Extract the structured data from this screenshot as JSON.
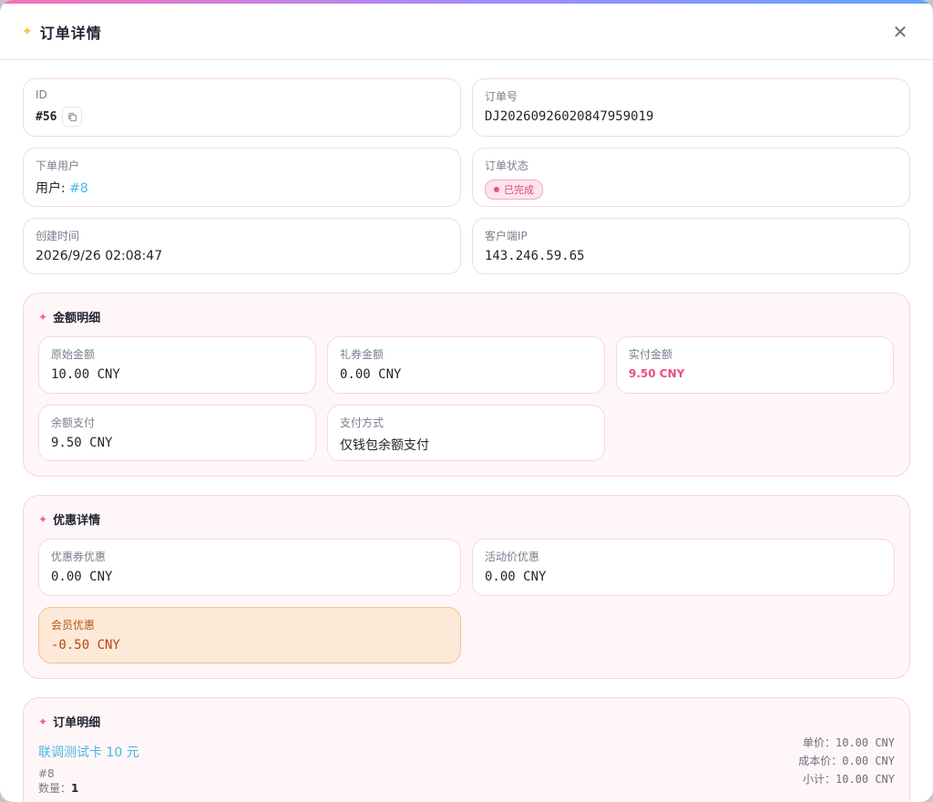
{
  "header": {
    "title": "订单详情",
    "close_icon": "close-icon"
  },
  "info": {
    "id": {
      "label": "ID",
      "value": "#56"
    },
    "order_no": {
      "label": "订单号",
      "value": "DJ20260926020847959019"
    },
    "user": {
      "label": "下单用户",
      "prefix": "用户:",
      "value": "#8"
    },
    "status": {
      "label": "订单状态",
      "value": "已完成"
    },
    "created": {
      "label": "创建时间",
      "value": "2026/9/26 02:08:47"
    },
    "ip": {
      "label": "客户端IP",
      "value": "143.246.59.65"
    }
  },
  "amounts": {
    "title": "金额明细",
    "items": [
      {
        "label": "原始金额",
        "value": "10.00 CNY"
      },
      {
        "label": "礼券金额",
        "value": "0.00 CNY"
      },
      {
        "label": "实付金额",
        "value": "9.50 CNY"
      },
      {
        "label": "余额支付",
        "value": "9.50 CNY"
      },
      {
        "label": "支付方式",
        "value": "仅钱包余额支付"
      }
    ]
  },
  "discounts": {
    "title": "优惠详情",
    "items": [
      {
        "label": "优惠券优惠",
        "value": "0.00 CNY"
      },
      {
        "label": "活动价优惠",
        "value": "0.00 CNY"
      },
      {
        "label": "会员优惠",
        "value": "-0.50 CNY"
      }
    ]
  },
  "order_items": {
    "title": "订单明细",
    "item": {
      "name": "联调测试卡 10 元",
      "id": "#8",
      "qty_label": "数量：",
      "qty": "1",
      "unit_price": "单价：10.00 CNY",
      "cost_price": "成本价：0.00 CNY",
      "subtotal": "小计：10.00 CNY"
    }
  },
  "colors": {
    "accent_pink": "#ec4d86",
    "link_blue": "#4fb6e3",
    "member_bg": "#fde9d7"
  }
}
